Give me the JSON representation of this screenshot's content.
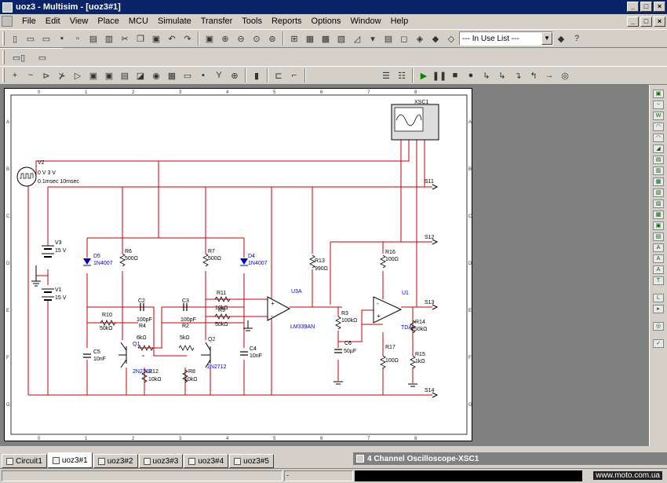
{
  "window": {
    "title": "uoz3 - Multisim - [uoz3#1]",
    "min": "_",
    "max": "□",
    "close": "×"
  },
  "menu": {
    "items": [
      "File",
      "Edit",
      "View",
      "Place",
      "MCU",
      "Simulate",
      "Transfer",
      "Tools",
      "Reports",
      "Options",
      "Window",
      "Help"
    ]
  },
  "toolbar": {
    "in_use_list": "--- In Use List ---"
  },
  "schematic": {
    "labels": {
      "v2": "V2",
      "v2a": "0 V 3 V",
      "v2b": "0.1msec 10msec",
      "v3": "V3",
      "v3v": "15 V",
      "v1": "V1",
      "v1v": "15 V",
      "d5": "D5",
      "d5m": "1N4007",
      "d4": "D4",
      "d4m": "1N4007",
      "r6": "R6",
      "r6v": "500Ω",
      "r7": "R7",
      "r7v": "500Ω",
      "r10": "R10",
      "r10v": "50kΩ",
      "r4": "R4",
      "r4v": "6kΩ",
      "r2": "R2",
      "r2v": "5kΩ",
      "r11": "R11",
      "r11v": "10kΩ",
      "r9": "R9",
      "r9v": "50kΩ",
      "c2": "C2",
      "c2v": "100pF",
      "c3": "C3",
      "c3v": "100pF",
      "c5": "C5",
      "c5v": "10nF",
      "c4": "C4",
      "c4v": "10nF",
      "q1": "Q1",
      "q1m": "2N2712",
      "q2": "Q2",
      "q2m": "2N2712",
      "r12": "R12",
      "r12v": "10kΩ",
      "r8": "R8",
      "r8v": "10kΩ",
      "u3a": "U3A",
      "lm": "LM339AN",
      "r13": "R13",
      "r13v": "990Ω",
      "r3": "R3",
      "r3v": "100kΩ",
      "c6": "C6",
      "c6v": "50µF",
      "r16": "R16",
      "r16v": "100Ω",
      "u1": "U1",
      "tda": "TDA",
      "r14": "R14",
      "r14v": "250kΩ",
      "r17": "R17",
      "r17v": "100Ω",
      "r15": "R15",
      "r15v": "1kΩ",
      "xsc1": "XSC1",
      "s11": "S11",
      "s12": "S12",
      "s13": "S13",
      "s14": "S14"
    },
    "ruler": {
      "cols": [
        "0",
        "1",
        "2",
        "3",
        "4",
        "5",
        "6",
        "7",
        "8"
      ],
      "rows": [
        "A",
        "B",
        "C",
        "D",
        "E",
        "F",
        "G"
      ]
    }
  },
  "tabs": [
    "Circuit1",
    "uoz3#1",
    "uoz3#2",
    "uoz3#3",
    "uoz3#4",
    "uoz3#5"
  ],
  "scope_window": {
    "title": "4 Channel Oscilloscope-XSC1"
  },
  "status": {
    "cell2": "-",
    "watermark": "www.moto.com.ua"
  },
  "colors": {
    "wire": "#cc0000",
    "component": "#000000",
    "diode": "#0000cc",
    "titlebar": "#0a246a"
  }
}
